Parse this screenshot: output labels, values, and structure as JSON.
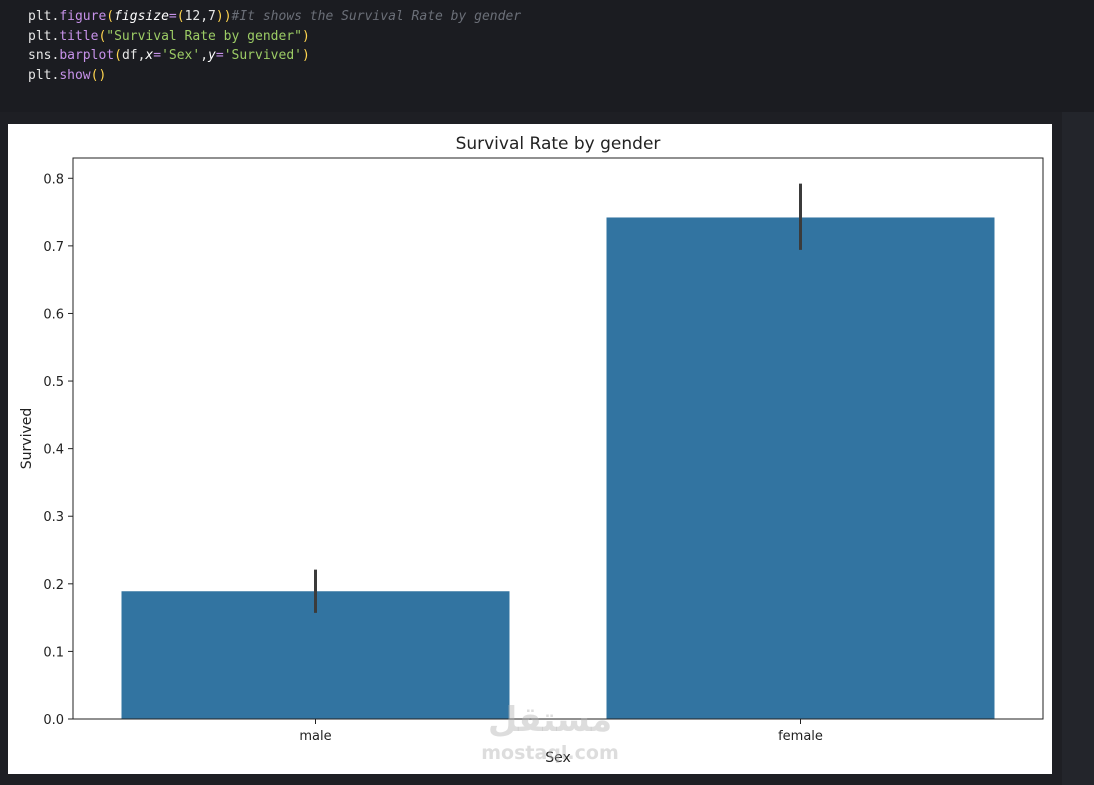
{
  "code_cell": {
    "lines": [
      "plt.figure(figsize=(12,7))#It shows the Survival Rate by gender",
      "plt.title(\"Survival Rate by gender\")",
      "sns.barplot(df,x='Sex',y='Survived')",
      "plt.show()"
    ]
  },
  "watermark": {
    "arabic": "مستقل",
    "latin": "mostaql.com"
  },
  "chart_data": {
    "type": "bar",
    "title": "Survival Rate by gender",
    "xlabel": "Sex",
    "ylabel": "Survived",
    "categories": [
      "male",
      "female"
    ],
    "values": [
      0.189,
      0.742
    ],
    "error_low": [
      0.157,
      0.694
    ],
    "error_high": [
      0.221,
      0.792
    ],
    "ylim": [
      0,
      0.83
    ],
    "yticks": [
      0.0,
      0.1,
      0.2,
      0.3,
      0.4,
      0.5,
      0.6,
      0.7,
      0.8
    ],
    "ytick_labels": [
      "0.0",
      "0.1",
      "0.2",
      "0.3",
      "0.4",
      "0.5",
      "0.6",
      "0.7",
      "0.8"
    ],
    "grid": false,
    "bar_color": "#3274a1",
    "errorbar_color": "#3b3b3b"
  }
}
